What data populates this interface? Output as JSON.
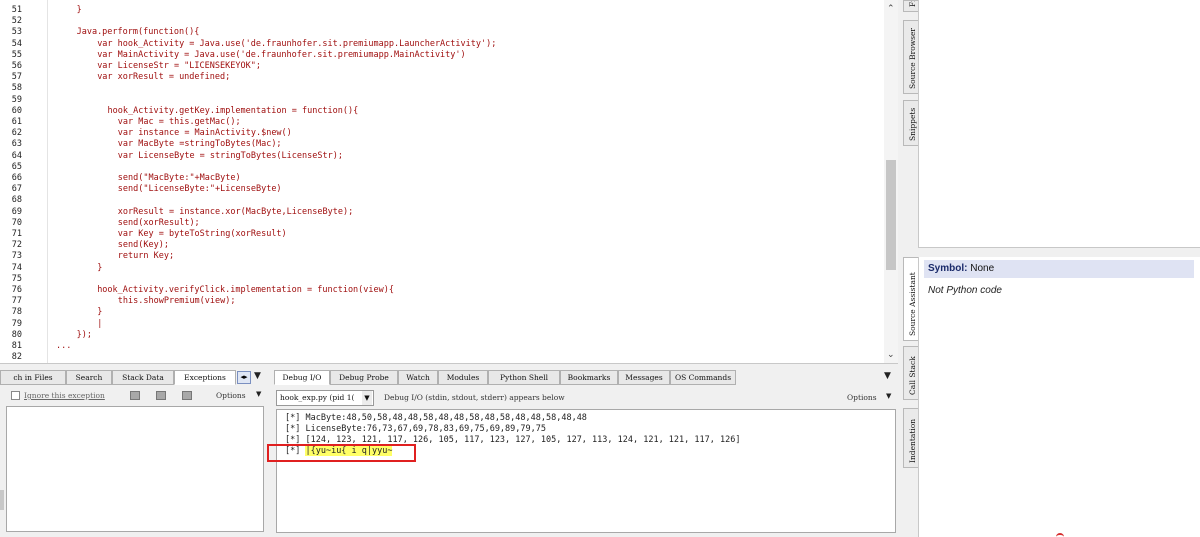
{
  "editor": {
    "lines": [
      {
        "n": "51",
        "indent": 2,
        "text": "}"
      },
      {
        "n": "52",
        "indent": 0,
        "text": ""
      },
      {
        "n": "53",
        "indent": 2,
        "text": "Java.perform(function(){"
      },
      {
        "n": "54",
        "indent": 4,
        "text": "var hook_Activity = Java.use('de.fraunhofer.sit.premiumapp.LauncherActivity');"
      },
      {
        "n": "55",
        "indent": 4,
        "text": "var MainActivity = Java.use('de.fraunhofer.sit.premiumapp.MainActivity')"
      },
      {
        "n": "56",
        "indent": 4,
        "text": "var LicenseStr = \"LICENSEKEYOK\";"
      },
      {
        "n": "57",
        "indent": 4,
        "text": "var xorResult = undefined;"
      },
      {
        "n": "58",
        "indent": 0,
        "text": ""
      },
      {
        "n": "59",
        "indent": 0,
        "text": ""
      },
      {
        "n": "60",
        "indent": 5,
        "text": "hook_Activity.getKey.implementation = function(){"
      },
      {
        "n": "61",
        "indent": 6,
        "text": "var Mac = this.getMac();"
      },
      {
        "n": "62",
        "indent": 6,
        "text": "var instance = MainActivity.$new()"
      },
      {
        "n": "63",
        "indent": 6,
        "text": "var MacByte =stringToBytes(Mac);"
      },
      {
        "n": "64",
        "indent": 6,
        "text": "var LicenseByte = stringToBytes(LicenseStr);"
      },
      {
        "n": "65",
        "indent": 0,
        "text": ""
      },
      {
        "n": "66",
        "indent": 6,
        "text": "send(\"MacByte:\"+MacByte)"
      },
      {
        "n": "67",
        "indent": 6,
        "text": "send(\"LicenseByte:\"+LicenseByte)"
      },
      {
        "n": "68",
        "indent": 0,
        "text": ""
      },
      {
        "n": "69",
        "indent": 6,
        "text": "xorResult = instance.xor(MacByte,LicenseByte);"
      },
      {
        "n": "70",
        "indent": 6,
        "text": "send(xorResult);"
      },
      {
        "n": "71",
        "indent": 6,
        "text": "var Key = byteToString(xorResult)"
      },
      {
        "n": "72",
        "indent": 6,
        "text": "send(Key);"
      },
      {
        "n": "73",
        "indent": 6,
        "text": "return Key;"
      },
      {
        "n": "74",
        "indent": 4,
        "text": "}"
      },
      {
        "n": "75",
        "indent": 0,
        "text": ""
      },
      {
        "n": "76",
        "indent": 4,
        "text": "hook_Activity.verifyClick.implementation = function(view){"
      },
      {
        "n": "77",
        "indent": 6,
        "text": "this.showPremium(view);"
      },
      {
        "n": "78",
        "indent": 4,
        "text": "}"
      },
      {
        "n": "79",
        "indent": 4,
        "text": "|"
      },
      {
        "n": "80",
        "indent": 2,
        "text": "});"
      },
      {
        "n": "81",
        "indent": 0,
        "text": "..."
      },
      {
        "n": "82",
        "indent": 0,
        "text": ""
      }
    ]
  },
  "right_tabs": [
    "Fr",
    "Source Browser",
    "Snippets",
    "Source Assistant",
    "Call Stack",
    "Indentation"
  ],
  "source_assistant": {
    "symbol_label": "Symbol:",
    "symbol_value": "None",
    "note": "Not Python code"
  },
  "bottom_left": {
    "tabs": [
      "ch in Files",
      "Search",
      "Stack Data",
      "Exceptions"
    ],
    "active_tab": "Exceptions",
    "ignore_label": "Ignore this exception",
    "options_label": "Options"
  },
  "debug_io": {
    "tabs": [
      "Debug I/O",
      "Debug Probe",
      "Watch",
      "Modules",
      "Python Shell",
      "Bookmarks",
      "Messages",
      "OS Commands"
    ],
    "active_tab": "Debug I/O",
    "process_select": "hook_exp.py (pid 1(",
    "hint": "Debug I/O (stdin, stdout, stderr) appears below",
    "options_label": "Options",
    "output": [
      "[*] MacByte:48,50,58,48,48,58,48,48,58,48,58,48,48,58,48,48",
      "[*] LicenseByte:76,73,67,69,78,83,69,75,69,89,79,75",
      "[*] [124, 123, 121, 117, 126, 105, 117, 123, 127, 105, 127, 113, 124, 121, 121, 117, 126]"
    ],
    "key_prefix": "[*] ",
    "key_value": "|{yu~iu{ i q|yyu~",
    "highlight_color": "#ffff66",
    "annotation_color": "#e02020"
  }
}
